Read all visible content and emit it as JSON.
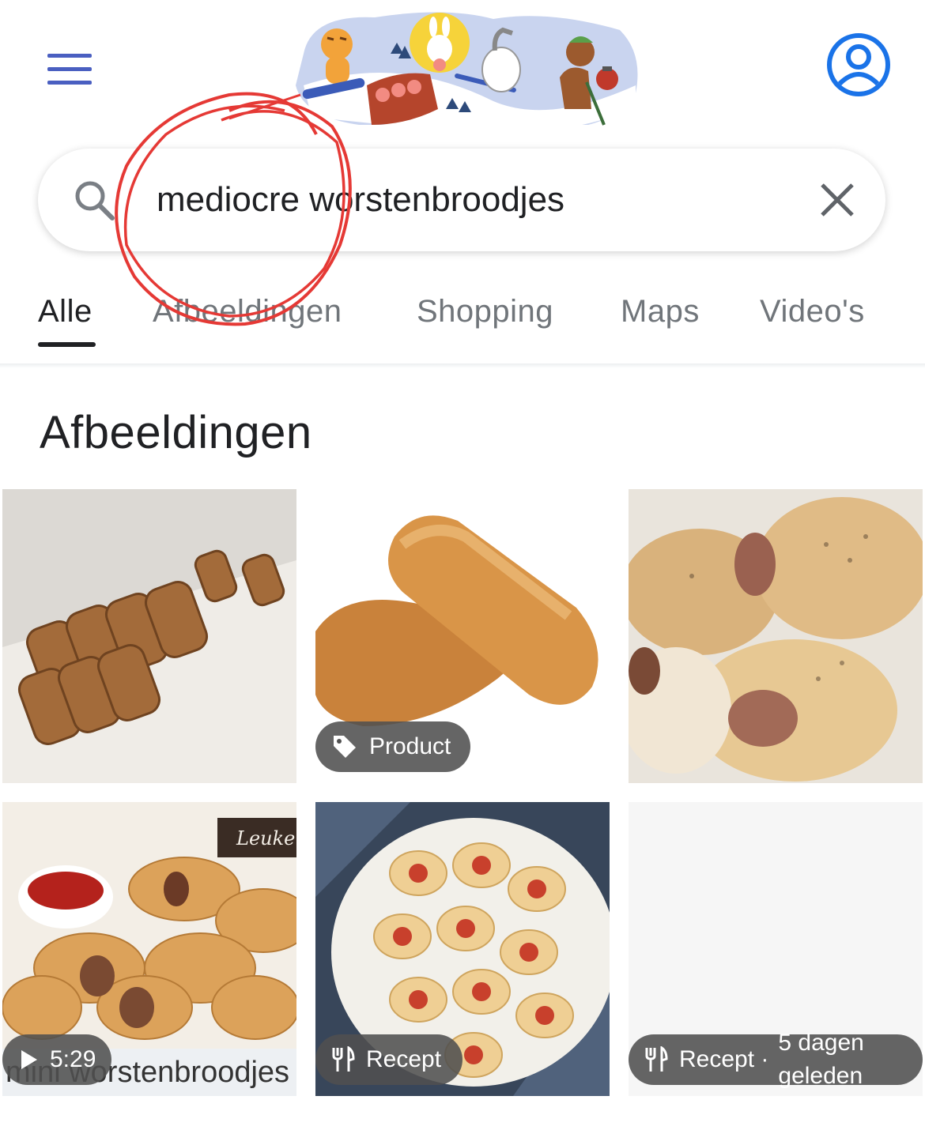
{
  "header": {
    "doodle_alt": "Google Doodle"
  },
  "search": {
    "query": "mediocre worstenbroodjes"
  },
  "tabs": [
    {
      "label": "Alle",
      "active": true
    },
    {
      "label": "Afbeeldingen",
      "active": false
    },
    {
      "label": "Shopping",
      "active": false
    },
    {
      "label": "Maps",
      "active": false
    },
    {
      "label": "Video's",
      "active": false
    }
  ],
  "section": {
    "title": "Afbeeldingen"
  },
  "images": [
    {
      "subject": "sausage rolls stacked on parchment"
    },
    {
      "subject": "long bread rolls",
      "badge": {
        "icon": "tag-icon",
        "label": "Product"
      }
    },
    {
      "subject": "sausages wrapped in seeded dough"
    },
    {
      "subject": "mini sausage rolls with ketchup",
      "overlay_text": "mini worstenbroodjes",
      "watermark": "Leuke",
      "badge": {
        "icon": "play-icon",
        "label": "5:29"
      }
    },
    {
      "subject": "pigs in a blanket on a plate",
      "badge": {
        "icon": "cutlery-icon",
        "label": "Recept"
      }
    },
    {
      "subject": "blank image",
      "badge": {
        "icon": "cutlery-icon",
        "label": "Recept ·",
        "extra_line1": "5 dagen",
        "extra_line2": "geleden"
      }
    }
  ],
  "colors": {
    "menu": "#4a5fc1",
    "account": "#1a73e8",
    "annotation": "#e53935",
    "badge_bg": "#505050"
  }
}
